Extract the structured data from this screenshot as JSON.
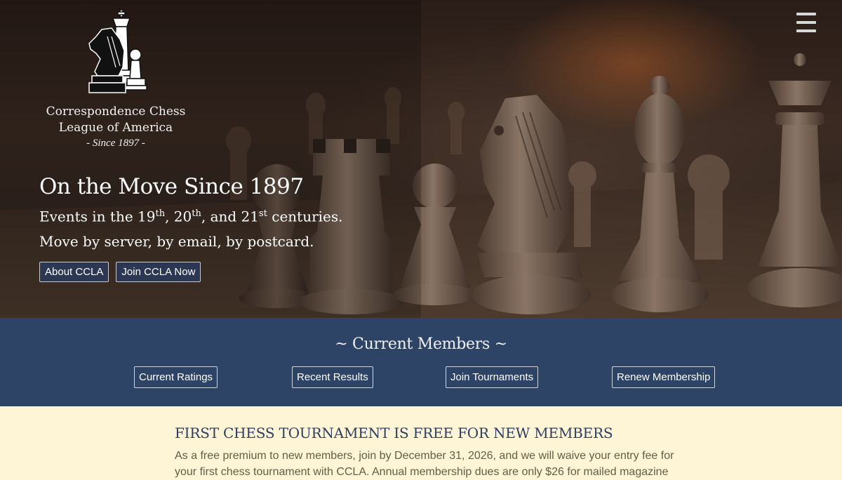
{
  "header": {
    "org_line1": "Correspondence Chess",
    "org_line2": "League of America",
    "since": "- Since 1897 -"
  },
  "hero": {
    "title": "On the Move Since 1897",
    "line1_a": "Events in the 19",
    "line1_sup1": "th",
    "line1_b": ", 20",
    "line1_sup2": "th",
    "line1_c": ", and 21",
    "line1_sup3": "st",
    "line1_d": " centuries.",
    "line2": "Move by server, by email, by postcard.",
    "buttons": [
      "About CCLA",
      "Join CCLA Now"
    ]
  },
  "members": {
    "heading": "~ Current Members ~",
    "buttons": [
      "Current Ratings",
      "Recent Results",
      "Join Tournaments",
      "Renew Membership"
    ]
  },
  "notice": {
    "heading": "FIRST CHESS TOURNAMENT IS FREE FOR NEW MEMBERS",
    "body": "As a free premium to new members, join by December 31, 2026, and we will waive your entry fee for your first chess tournament with CCLA. Annual membership dues are only $26 for mailed magazine"
  },
  "icons": {
    "menu": "hamburger-menu-icon",
    "logo": "chess-pieces-logo-icon"
  },
  "colors": {
    "members_band": "#2e4466",
    "notice_bg": "#fdf5d6",
    "button_border": "#c9c9c9"
  }
}
